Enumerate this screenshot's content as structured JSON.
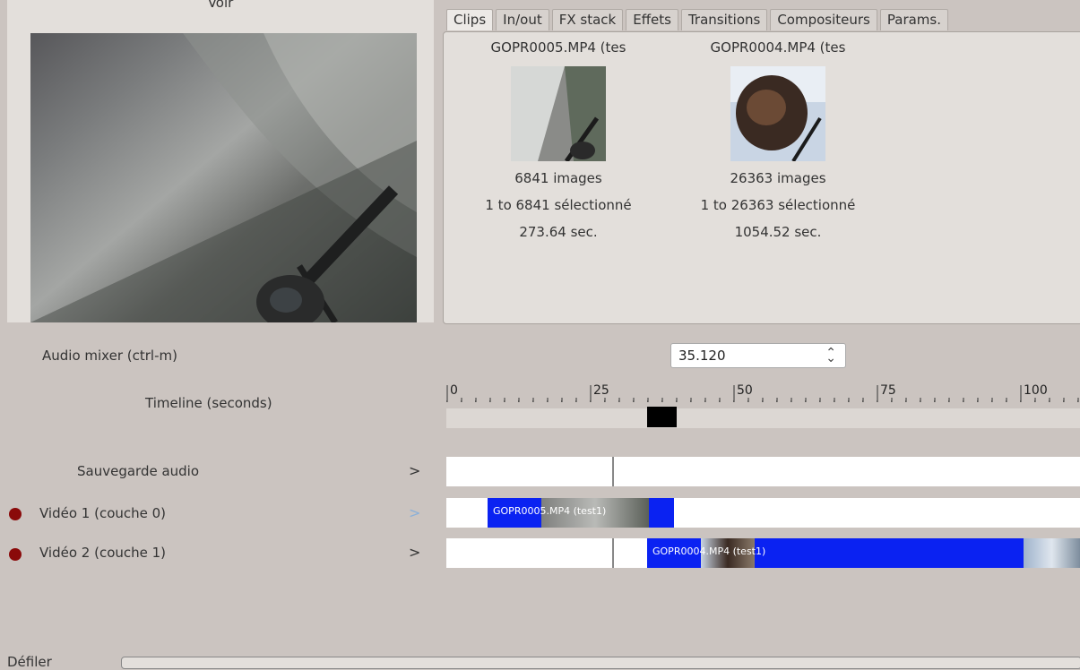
{
  "preview": {
    "title": "Voir"
  },
  "tabs": [
    {
      "label": "Clips"
    },
    {
      "label": "In/out"
    },
    {
      "label": "FX stack"
    },
    {
      "label": "Effets"
    },
    {
      "label": "Transitions"
    },
    {
      "label": "Compositeurs"
    },
    {
      "label": "Params."
    }
  ],
  "clips": [
    {
      "name": "GOPR0005.MP4 (tes",
      "images": "6841 images",
      "selection": "1 to 6841 sélectionné",
      "duration": "273.64 sec."
    },
    {
      "name": "GOPR0004.MP4 (tes",
      "images": "26363 images",
      "selection": "1 to 26363 sélectionné",
      "duration": "1054.52 sec."
    }
  ],
  "controls": {
    "audio_mixer": "Audio mixer (ctrl-m)",
    "timeline_label": "Timeline (seconds)",
    "position_value": "35.120"
  },
  "ruler": {
    "ticks": [
      "0",
      "25",
      "50",
      "75",
      "100"
    ]
  },
  "tracks": [
    {
      "name": "Sauvegarde audio"
    },
    {
      "name": "Vidéo 1 (couche 0)",
      "clip_label": "GOPR0005.MP4 (test1)"
    },
    {
      "name": "Vidéo 2 (couche 1)",
      "clip_label": "GOPR0004.MP4 (test1)"
    }
  ],
  "footer": {
    "scroll_label": "Défiler"
  },
  "colors": {
    "clip_blue": "#0a22f2",
    "record_dot": "#8a0a0a",
    "background": "#cbc4c0"
  }
}
